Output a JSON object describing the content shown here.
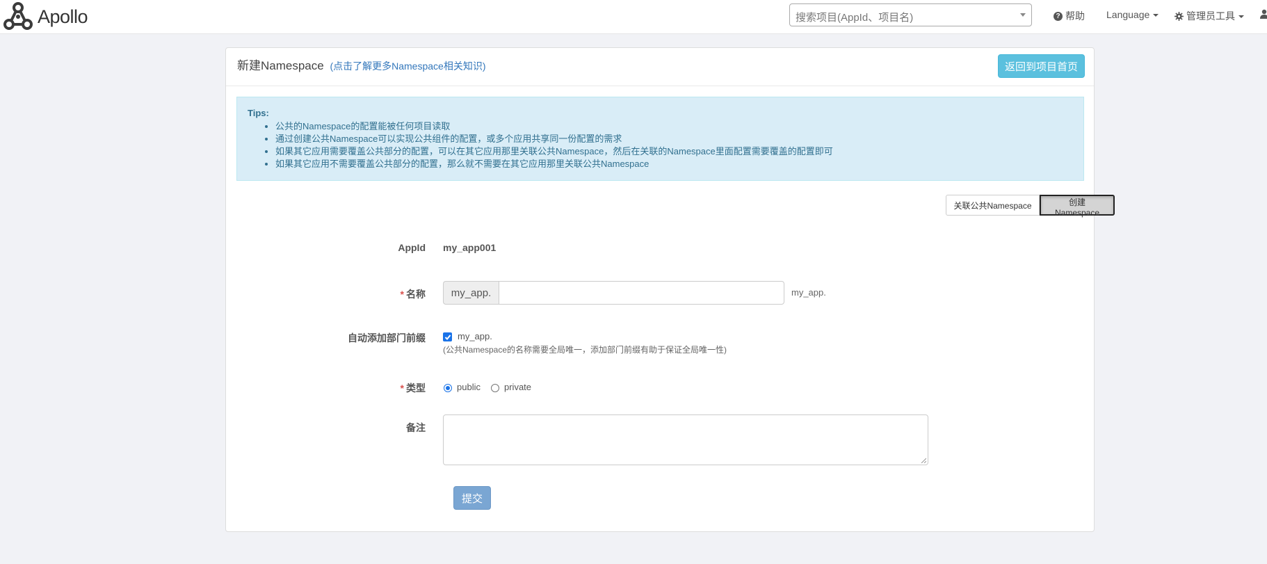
{
  "navbar": {
    "logo_text": "Apollo",
    "search_placeholder": "搜索项目(AppId、项目名)",
    "help_label": "帮助",
    "language_label": "Language",
    "admin_tools_label": "管理员工具"
  },
  "panel": {
    "title": "新建Namespace",
    "learn_more_link": "(点击了解更多Namespace相关知识)",
    "back_button": "返回到项目首页"
  },
  "tips": {
    "title": "Tips:",
    "items": [
      "公共的Namespace的配置能被任何项目读取",
      "通过创建公共Namespace可以实现公共组件的配置，或多个应用共享同一份配置的需求",
      "如果其它应用需要覆盖公共部分的配置，可以在其它应用那里关联公共Namespace，然后在关联的Namespace里面配置需要覆盖的配置即可",
      "如果其它应用不需要覆盖公共部分的配置，那么就不需要在其它应用那里关联公共Namespace"
    ]
  },
  "toggle": {
    "link_public": "关联公共Namespace",
    "create": "创建Namespace",
    "selected": "create"
  },
  "form": {
    "appid_label": "AppId",
    "appid_value": "my_app001",
    "name_label": "名称",
    "name_prefix": "my_app.",
    "name_value": "",
    "name_suffix_preview": "my_app.",
    "auto_prefix_label": "自动添加部门前缀",
    "auto_prefix_checked": true,
    "auto_prefix_text": "my_app.",
    "auto_prefix_hint": "(公共Namespace的名称需要全局唯一，添加部门前缀有助于保证全局唯一性)",
    "type_label": "类型",
    "type_options": [
      "public",
      "private"
    ],
    "type_selected": "public",
    "comment_label": "备注",
    "comment_value": "",
    "submit_label": "提交"
  },
  "colors": {
    "info_button": "#5bc0de",
    "primary_button": "#7aa6d3",
    "tips_bg": "#d9edf7",
    "tips_text": "#31708f",
    "required_mark": "#d9534f",
    "page_bg": "#f1f2f6"
  },
  "icons": {
    "logo": "apollo-logo-icon",
    "help": "question-circle-icon",
    "admin": "gear-icon",
    "user": "user-icon"
  }
}
